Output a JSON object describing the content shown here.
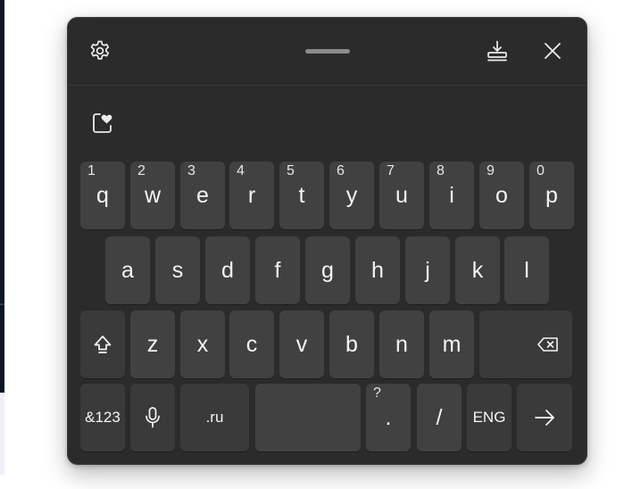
{
  "titlebar": {
    "settings_icon": "gear-icon",
    "dock_icon": "dock-download-icon",
    "close_icon": "close-icon"
  },
  "clipboard_icon": "clipboard-heart-icon",
  "rows": {
    "row1": [
      {
        "letter": "q",
        "number": "1"
      },
      {
        "letter": "w",
        "number": "2"
      },
      {
        "letter": "e",
        "number": "3"
      },
      {
        "letter": "r",
        "number": "4"
      },
      {
        "letter": "t",
        "number": "5"
      },
      {
        "letter": "y",
        "number": "6"
      },
      {
        "letter": "u",
        "number": "7"
      },
      {
        "letter": "i",
        "number": "8"
      },
      {
        "letter": "o",
        "number": "9"
      },
      {
        "letter": "p",
        "number": "0"
      }
    ],
    "row2": [
      "a",
      "s",
      "d",
      "f",
      "g",
      "h",
      "j",
      "k",
      "l"
    ],
    "row3": [
      "z",
      "x",
      "c",
      "v",
      "b",
      "n",
      "m"
    ],
    "row4": {
      "symbols": "&123",
      "domain": ".ru",
      "period": ".",
      "period_alt": "?",
      "slash": "/",
      "language": "ENG"
    }
  },
  "colors": {
    "panel": "#2b2b2b",
    "key": "#414141",
    "key_text": "#f4f4f4"
  }
}
